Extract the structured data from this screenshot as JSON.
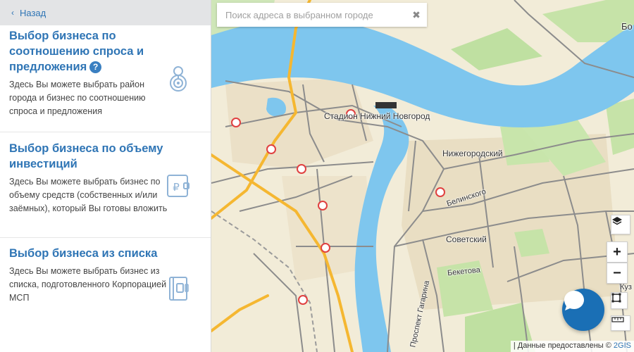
{
  "sidebar": {
    "back_label": "Назад",
    "cards": [
      {
        "title": "Выбор бизнеса по соотношению спроса и предложения",
        "help_symbol": "?",
        "description": "Здесь Вы можете выбрать район города и бизнес по соотношению спроса и предложения",
        "icon": "location-pin-icon"
      },
      {
        "title": "Выбор бизнеса по объему инвестиций",
        "description": "Здесь Вы можете выбрать бизнес по объему средств (собственных и/или заёмных), который Вы готовы вложить",
        "icon": "ruble-wallet-icon"
      },
      {
        "title": "Выбор бизнеса из списка",
        "description": "Здесь Вы можете выбрать бизнес из списка, подготовленного Корпорацией МСП",
        "icon": "list-book-icon"
      }
    ]
  },
  "map": {
    "search_placeholder": "Поиск адреса в выбранном городе",
    "labels": {
      "stadium": "Стадион Нижний Новгород",
      "nizhegorodsky": "Нижегородский",
      "sovetsky": "Советский",
      "belinskogo": "Белинского",
      "beketova": "Бекетова",
      "gagarina": "Проспект Гагарина",
      "top_right": "Бо",
      "kuz": "Куз"
    },
    "attribution_text": "| Данные предоставлены ©",
    "attribution_brand": "2GIS",
    "colors": {
      "water": "#7ec6ee",
      "park": "#bfe0a1",
      "road_major": "#f5b731",
      "road_minor": "#8c8c8c",
      "accent": "#2f75b5",
      "chat": "#1a6fb5"
    }
  }
}
